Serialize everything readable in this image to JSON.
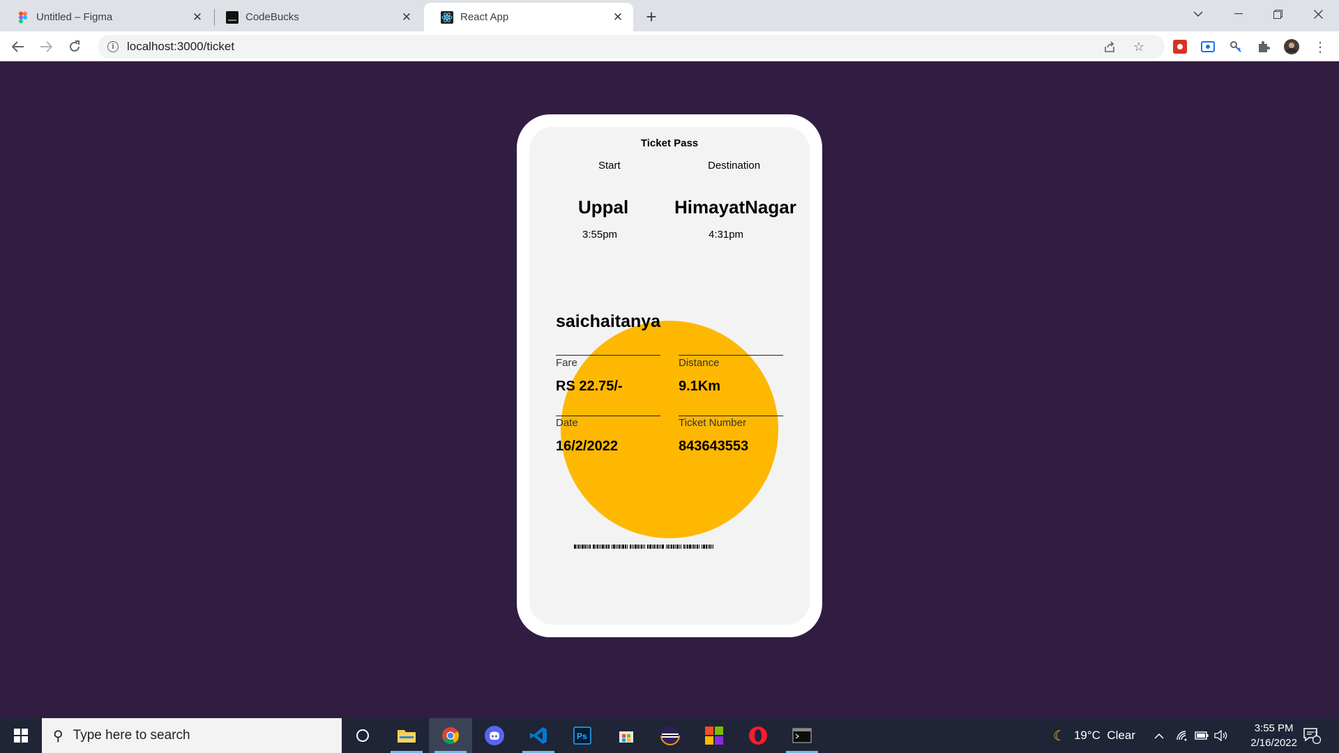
{
  "browser": {
    "tabs": [
      {
        "title": "Untitled – Figma",
        "favicon": "figma-icon"
      },
      {
        "title": "CodeBucks",
        "favicon": "codebucks-icon"
      },
      {
        "title": "React App",
        "favicon": "react-icon",
        "active": true
      }
    ],
    "url": "localhost:3000/ticket"
  },
  "ticket": {
    "title": "Ticket Pass",
    "start_label": "Start",
    "destination_label": "Destination",
    "start_city": "Uppal",
    "destination_city": "HimayatNagar",
    "start_time": "3:55pm",
    "destination_time": "4:31pm",
    "passenger": "saichaitanya",
    "fare_label": "Fare",
    "fare_value": "RS 22.75/-",
    "distance_label": "Distance",
    "distance_value": "9.1Km",
    "date_label": "Date",
    "date_value": "16/2/2022",
    "ticket_number_label": "Ticket Number",
    "ticket_number_value": "843643553"
  },
  "colors": {
    "page_background": "#311d42",
    "accent_circle": "#feb802",
    "card": "#f3f3f3"
  },
  "taskbar": {
    "search_placeholder": "Type here to search",
    "apps": [
      "cortana-icon",
      "file-explorer-icon",
      "chrome-icon",
      "discord-icon",
      "vscode-icon",
      "photoshop-icon",
      "store-icon",
      "eclipse-icon",
      "ms-office-icon",
      "opera-icon",
      "terminal-icon"
    ],
    "weather": "19°C  Clear",
    "time": "3:55 PM",
    "date": "2/16/2022",
    "notifications": "1"
  }
}
